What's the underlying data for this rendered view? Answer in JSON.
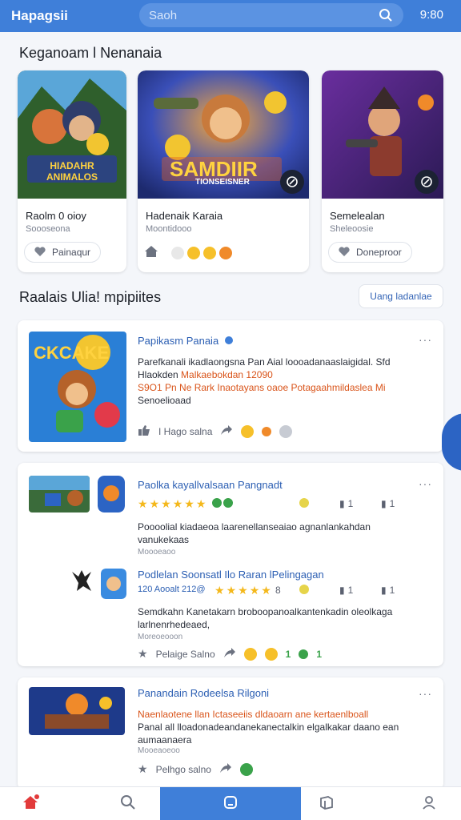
{
  "header": {
    "brand": "Hapagsii",
    "search_placeholder": "Saoh",
    "clock": "9:80"
  },
  "section1": {
    "title": "Keganoam l Nenanaia",
    "cards": [
      {
        "art_text": "HIADAHR ANIMALOS",
        "title": "Raolm 0 oioy",
        "subtitle": "Soooseona",
        "pill_label": "Painaqur"
      },
      {
        "art_text": "SAMDIIR",
        "art_subtext": "TIONSEISNER",
        "title": "Hadenaik Karaia",
        "subtitle": "Moontidooo"
      },
      {
        "title": "Semelealan",
        "subtitle": "Sheleoosie",
        "pill_label": "Doneproor"
      }
    ]
  },
  "section2": {
    "title": "Raalais   Ulia! mpipiites",
    "button_label": "Uang ladanlae"
  },
  "posts": [
    {
      "art_text": "CKCAKE",
      "title": "Papikasm Panaia",
      "line1": "Parefkanali ikadlaongsna Pan Aial loooadanaaslaigidal. Sfd",
      "line2_plain": "Hlaokden ",
      "line2_hl": "Malkaebokdan 12090",
      "line3": "S9O1 Pn Ne Rark Inaotayans oaoe Potagaahmildaslea Mi",
      "line4": "Senoelioaad",
      "action_label": "I Hago salna"
    },
    {
      "title_a": "Paolka kayallvalsaan Pangnadt",
      "rating_a": "4.5",
      "stat_a1": "1",
      "stat_a2": "1",
      "text_a1": "Poooolial kiadaeoa laarenellanseaiao agnanlankahdan",
      "text_a2": "vanukekaas",
      "meta_a": "Moooeaoo",
      "title_b": "Podlelan Soonsatl Ilo Raran lPelingagan",
      "meta_b": "120 Aooalt 212@",
      "rating_b": "4.5",
      "stat_b0": "8",
      "stat_b1": "1",
      "stat_b2": "1",
      "text_b1": "Semdkahn Kanetakarn broboopanoalkantenkadin oleolkaga",
      "text_b2": "larlnenrhedeaed,",
      "meta_b2": "Moreoeooon",
      "action_label": "Pelaige Salno",
      "count_1": "1",
      "count_2": "1"
    },
    {
      "title": "Panandain Rodeelsa Rilgoni",
      "line1": "Naenlaotene llan Ictaseeiis dldaoarn ane kertaenlboall",
      "line2": "Panal all lloadonadeandanekanectalkin elgalkakar daano  ean",
      "line3": "aumaanaera",
      "meta": "Mooeaoeoo",
      "action_label": "Pelhgo salno"
    }
  ],
  "colors": {
    "primary": "#3f7fd9",
    "link_blue": "#2c5fb3",
    "highlight_orange": "#d9541a",
    "star": "#f4b81b"
  },
  "bottom_nav": [
    "home-icon",
    "search-icon",
    "chat-icon",
    "box-icon",
    "profile-icon"
  ]
}
